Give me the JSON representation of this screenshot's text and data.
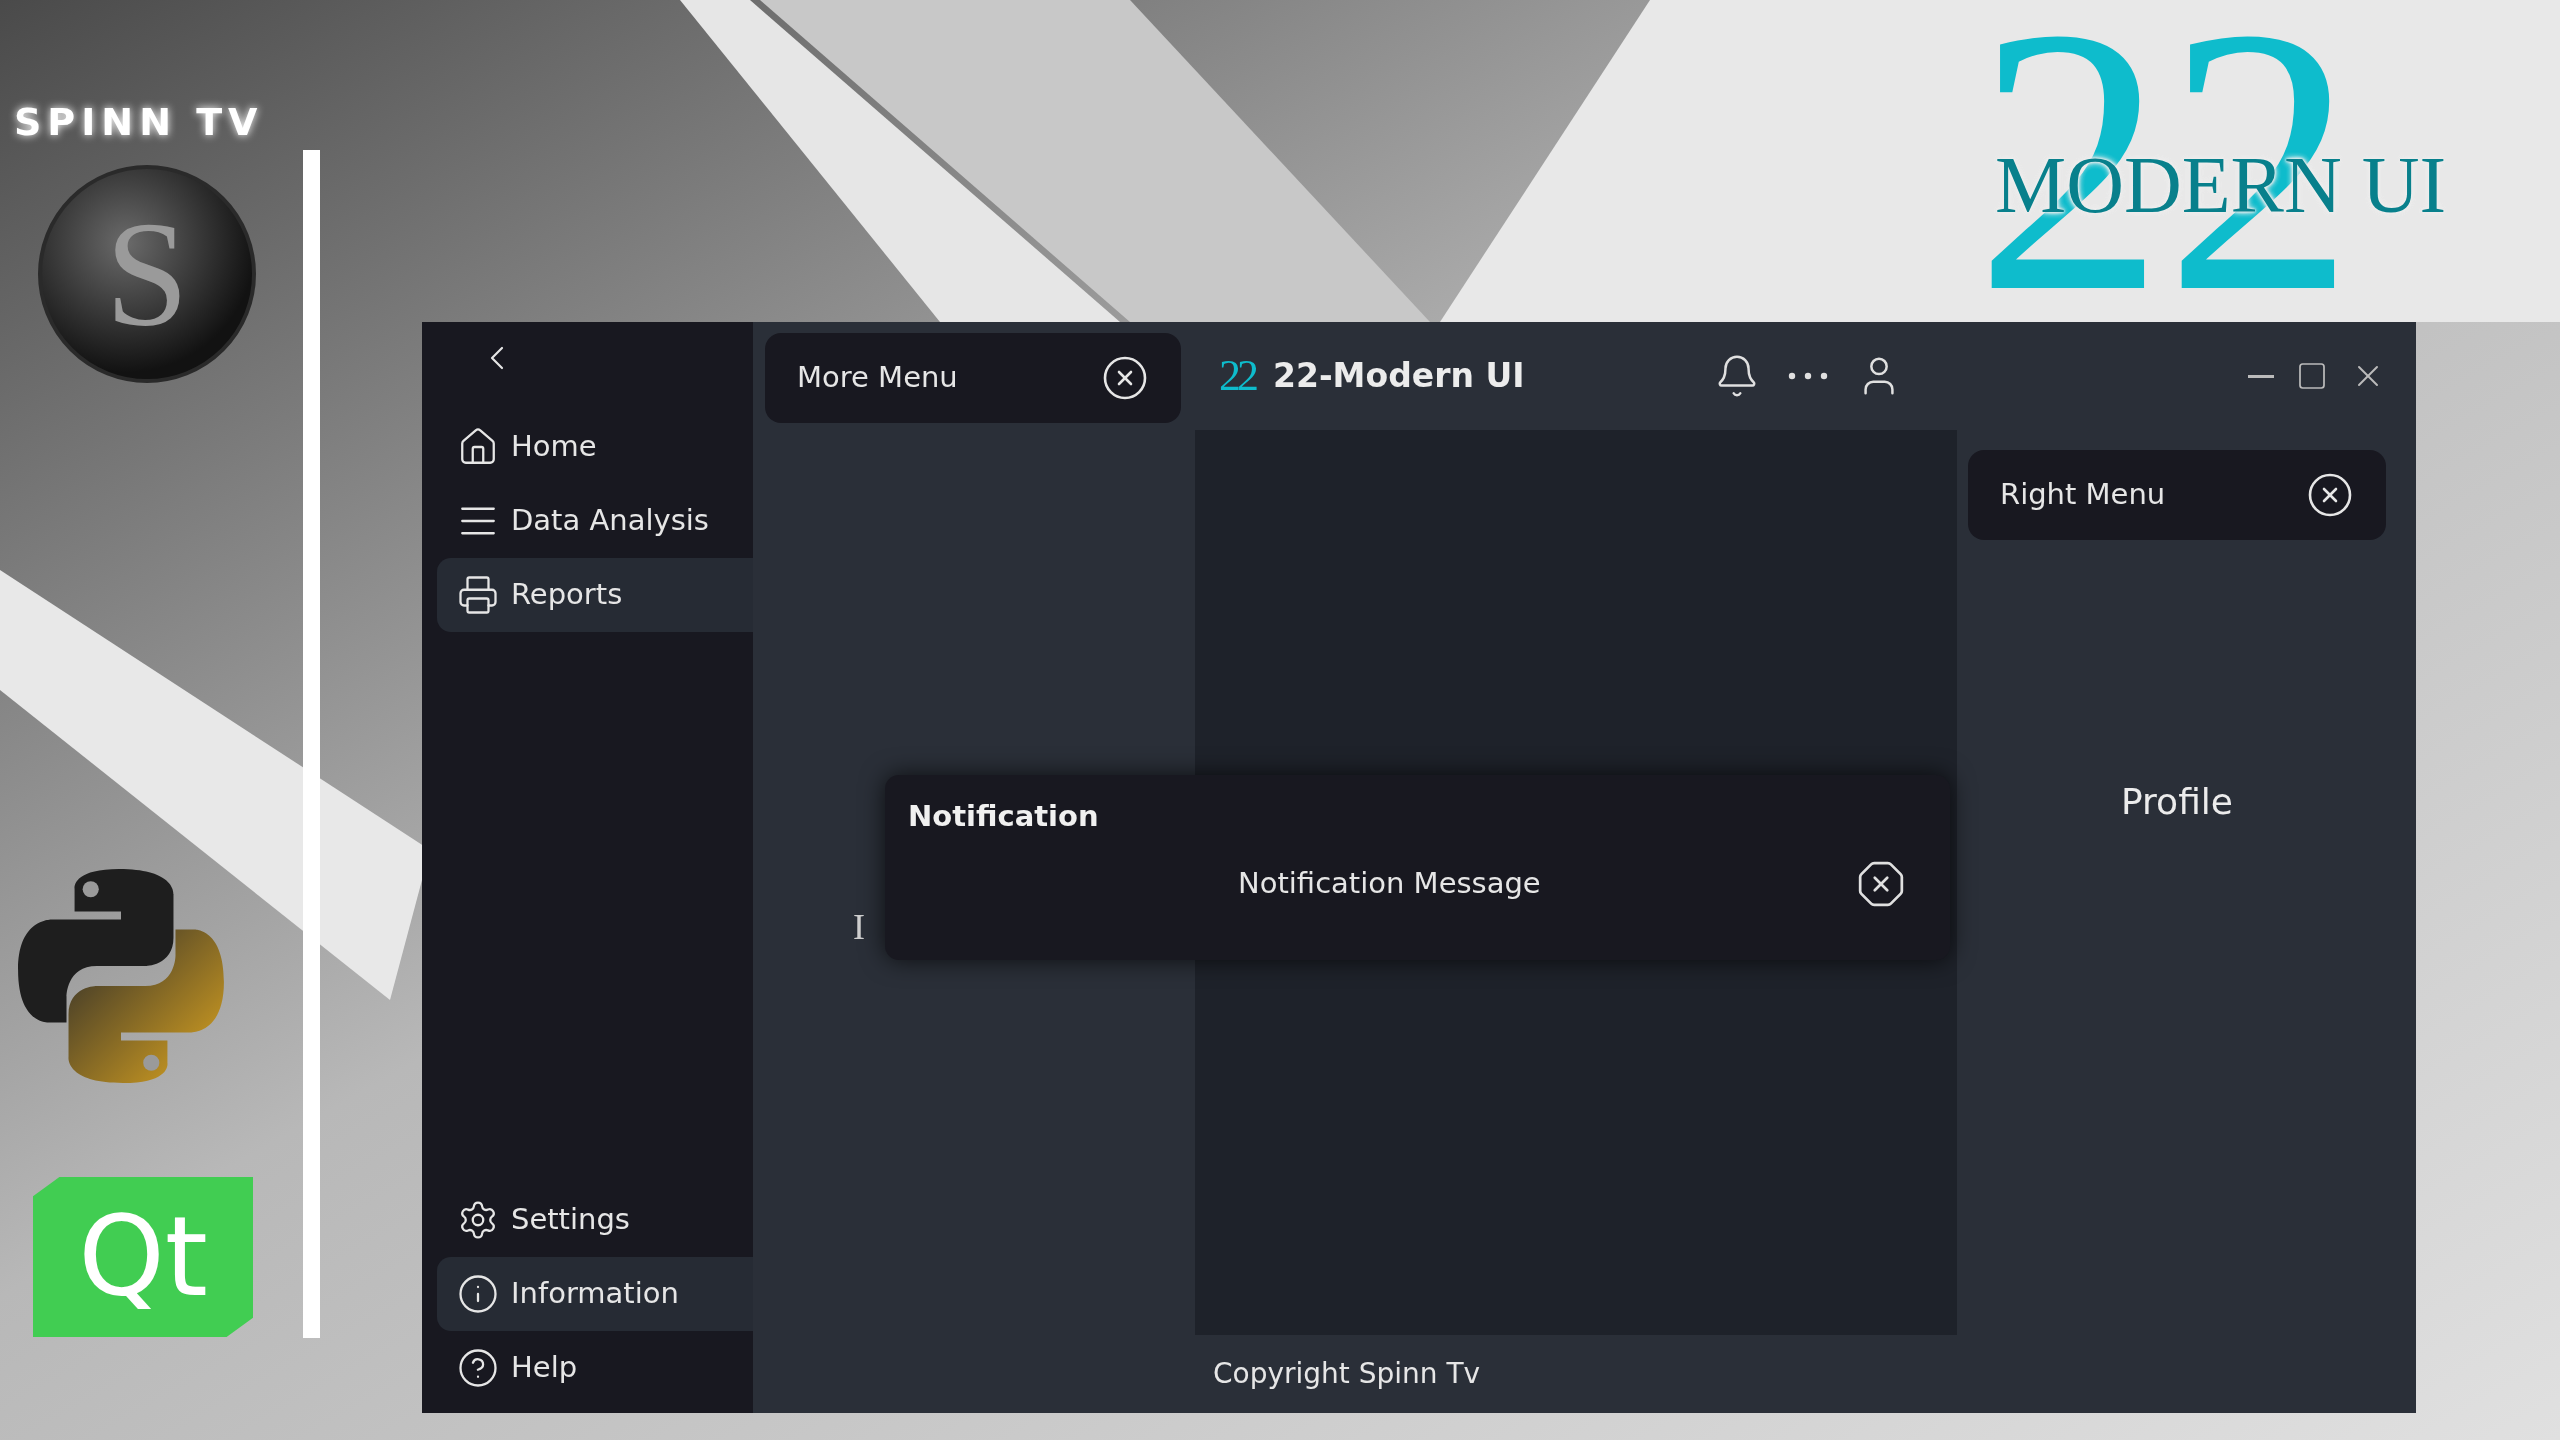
{
  "brand": {
    "channel": "SPINN TV",
    "logo_letter": "S",
    "qt_logo": "Qt",
    "title_logo": {
      "number": "22",
      "subtitle": "MODERN UI"
    }
  },
  "sidebar": {
    "top_items": [
      {
        "label": "Home",
        "selected": false
      },
      {
        "label": "Data Analysis",
        "selected": false
      },
      {
        "label": "Reports",
        "selected": true
      }
    ],
    "bottom_items": [
      {
        "label": "Settings",
        "selected": false
      },
      {
        "label": "Information",
        "selected": true
      },
      {
        "label": "Help",
        "selected": false
      }
    ]
  },
  "more_menu": {
    "title": "More Menu",
    "partial_text": "I"
  },
  "window": {
    "logo": "22",
    "title": "22-Modern UI"
  },
  "notification": {
    "title": "Notification",
    "message": "Notification Message"
  },
  "right_menu": {
    "title": "Right Menu",
    "content": "Profile"
  },
  "status_bar": {
    "text": "Copyright Spinn Tv"
  }
}
